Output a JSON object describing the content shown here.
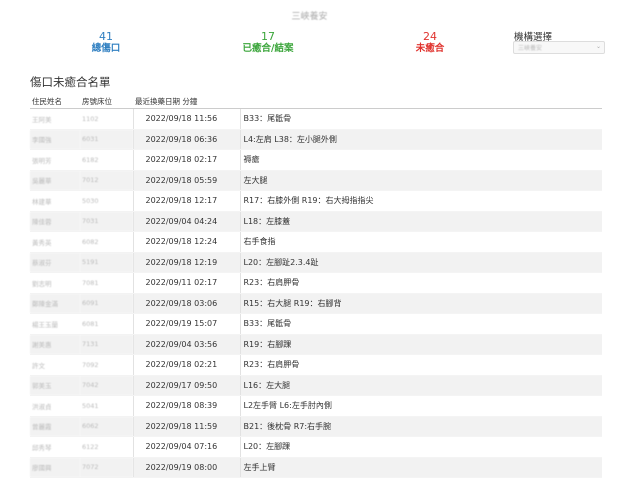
{
  "header": {
    "title": "三峽養安"
  },
  "stats": [
    {
      "value": "41",
      "label": "總傷口",
      "color": "#2f7fc1"
    },
    {
      "value": "17",
      "label": "已癒合/結案",
      "color": "#3aa53a"
    },
    {
      "value": "24",
      "label": "未癒合",
      "color": "#e0342f"
    }
  ],
  "org": {
    "label": "機構選擇",
    "selected": "三峽養安"
  },
  "section_title": "傷口未癒合名單",
  "table": {
    "headers": [
      "住民姓名",
      "房號床位",
      "最近換藥日期 分鐘",
      ""
    ],
    "rows": [
      {
        "name": "王阿美",
        "bed": "1102",
        "date": "2022/09/18 11:56",
        "wound": "B33：尾骶骨"
      },
      {
        "name": "李國強",
        "bed": "6031",
        "date": "2022/09/18 06:36",
        "wound": "L4:左肩  L38：左小腿外側"
      },
      {
        "name": "張明芳",
        "bed": "6182",
        "date": "2022/09/18 02:17",
        "wound": "褥瘡"
      },
      {
        "name": "吳麗華",
        "bed": "7012",
        "date": "2022/09/18 05:59",
        "wound": "左大腿"
      },
      {
        "name": "林建華",
        "bed": "5030",
        "date": "2022/09/18 12:17",
        "wound": "R17：右膝外側  R19：右大拇指指尖"
      },
      {
        "name": "陳佳蓉",
        "bed": "7031",
        "date": "2022/09/04 04:24",
        "wound": "L18：左膝蓋"
      },
      {
        "name": "黃秀英",
        "bed": "6082",
        "date": "2022/09/18 12:24",
        "wound": "右手食指"
      },
      {
        "name": "蔡淑芬",
        "bed": "5191",
        "date": "2022/09/18 12:19",
        "wound": "L20：左腳趾2.3.4趾"
      },
      {
        "name": "劉志明",
        "bed": "7081",
        "date": "2022/09/11 02:17",
        "wound": "R23：右肩胛骨"
      },
      {
        "name": "鄭陳金滿",
        "bed": "6091",
        "date": "2022/09/18 03:06",
        "wound": "R15：右大腿  R19：右腳背"
      },
      {
        "name": "楊王玉蘭",
        "bed": "6081",
        "date": "2022/09/19 15:07",
        "wound": "B33：尾骶骨"
      },
      {
        "name": "謝美惠",
        "bed": "7131",
        "date": "2022/09/04 03:56",
        "wound": "R19：右腳踝"
      },
      {
        "name": "許文",
        "bed": "7092",
        "date": "2022/09/18 02:21",
        "wound": "R23：右肩胛骨"
      },
      {
        "name": "郭美玉",
        "bed": "7042",
        "date": "2022/09/17 09:50",
        "wound": "L16：左大腿"
      },
      {
        "name": "洪淑貞",
        "bed": "5041",
        "date": "2022/09/18 08:39",
        "wound": "L2左手臂  L6:左手肘內側"
      },
      {
        "name": "曾麗霞",
        "bed": "6062",
        "date": "2022/09/18 11:59",
        "wound": "B21：後枕骨  R7:右手腕"
      },
      {
        "name": "邱秀琴",
        "bed": "6122",
        "date": "2022/09/04 07:16",
        "wound": "L20：左腳踝"
      },
      {
        "name": "廖國興",
        "bed": "7072",
        "date": "2022/09/19 08:00",
        "wound": "左手上臂"
      }
    ]
  }
}
